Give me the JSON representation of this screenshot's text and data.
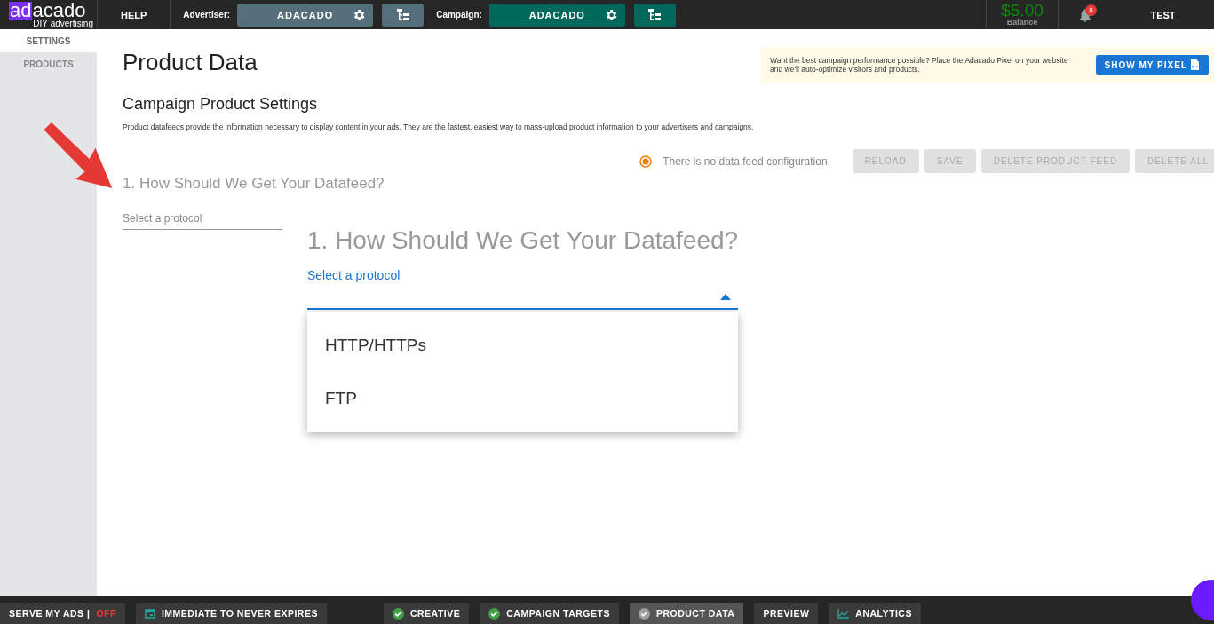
{
  "topbar": {
    "logo": {
      "mark": "ad",
      "rest": "acado",
      "tagline": "DIY advertising"
    },
    "help": "HELP",
    "selectors": [
      {
        "label": "Advertiser:",
        "value": "ADACADO",
        "kind": "advertiser"
      },
      {
        "label": "Campaign:",
        "value": "ADACADO",
        "kind": "campaign"
      }
    ],
    "balance": {
      "amount": "$5.00",
      "label": "Balance"
    },
    "notifications": "8",
    "user": "TEST"
  },
  "sidebar": {
    "items": [
      {
        "label": "SETTINGS",
        "selected": true
      },
      {
        "label": "PRODUCTS",
        "selected": false
      }
    ]
  },
  "page": {
    "title": "Product Data",
    "banner": {
      "text": "Want the best campaign performance possible? Place the Adacado Pixel on your website and we'll auto-optimize visitors and products.",
      "button": "SHOW MY PIXEL"
    },
    "subtitle": "Campaign Product Settings",
    "description": "Product datafeeds provide the information necessary to display content in your ads. They are the fastest, easiest way to mass-upload product information to your advertisers and campaigns.",
    "status": "There is no data feed configuration",
    "actions": [
      {
        "label": "RELOAD",
        "disabled": true
      },
      {
        "label": "SAVE",
        "disabled": true
      },
      {
        "label": "DELETE PRODUCT FEED",
        "disabled": true
      },
      {
        "label": "DELETE ALL",
        "disabled": true
      }
    ],
    "section_heading": "1. How Should We Get Your Datafeed?",
    "protocol_placeholder": "Select a protocol"
  },
  "zoomed": {
    "heading": "1. How Should We Get Your Datafeed?",
    "label": "Select a protocol",
    "expanded": true,
    "options": [
      {
        "label": "HTTP/HTTPs",
        "selected": false
      },
      {
        "label": "FTP",
        "selected": false
      }
    ]
  },
  "bottom_bar": {
    "serve_label": "SERVE MY ADS |",
    "serve_state": "OFF",
    "schedule": "IMMEDIATE TO NEVER EXPIRES",
    "steps": [
      {
        "label": "CREATIVE",
        "kind": "done",
        "selected": false
      },
      {
        "label": "CAMPAIGN TARGETS",
        "kind": "done",
        "selected": false
      },
      {
        "label": "PRODUCT DATA",
        "kind": "done",
        "selected": true
      },
      {
        "label": "PREVIEW",
        "kind": "plain",
        "selected": false
      },
      {
        "label": "ANALYTICS",
        "kind": "chart",
        "selected": false
      }
    ]
  }
}
